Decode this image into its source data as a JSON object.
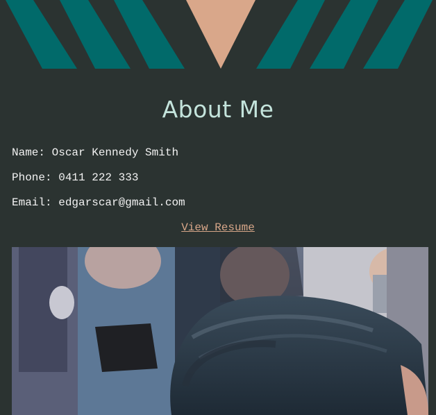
{
  "about": {
    "title": "About Me",
    "name_line": "Name: Oscar Kennedy Smith",
    "phone_line": "Phone: 0411 222 333",
    "email_line": "Email: edgarscar@gmail.com",
    "resume_link": "View Resume"
  },
  "colors": {
    "background": "#2b3331",
    "stripe_teal": "#016a6a",
    "triangle_peach": "#d9a78a",
    "title": "#c4e4dc",
    "link": "#d8a789"
  },
  "photo": {
    "icon": "profile-selfie-photo"
  }
}
